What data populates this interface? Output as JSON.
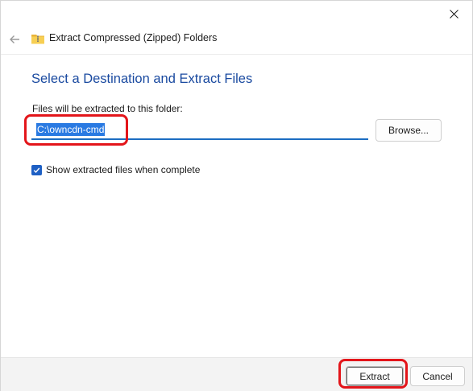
{
  "window": {
    "close_icon": "close-icon"
  },
  "header": {
    "back_icon": "back-arrow-icon",
    "folder_icon": "zip-folder-icon",
    "title": "Extract Compressed (Zipped) Folders"
  },
  "main": {
    "heading": "Select a Destination and Extract Files",
    "destination_label": "Files will be extracted to this folder:",
    "destination_value": "C:\\owncdn-cmd",
    "browse_label": "Browse...",
    "show_files_label": "Show extracted files when complete",
    "show_files_checked": true
  },
  "footer": {
    "extract_label": "Extract",
    "cancel_label": "Cancel"
  },
  "colors": {
    "accent": "#1c6dc2",
    "heading": "#1a4aa0",
    "highlight": "#e3151a"
  }
}
